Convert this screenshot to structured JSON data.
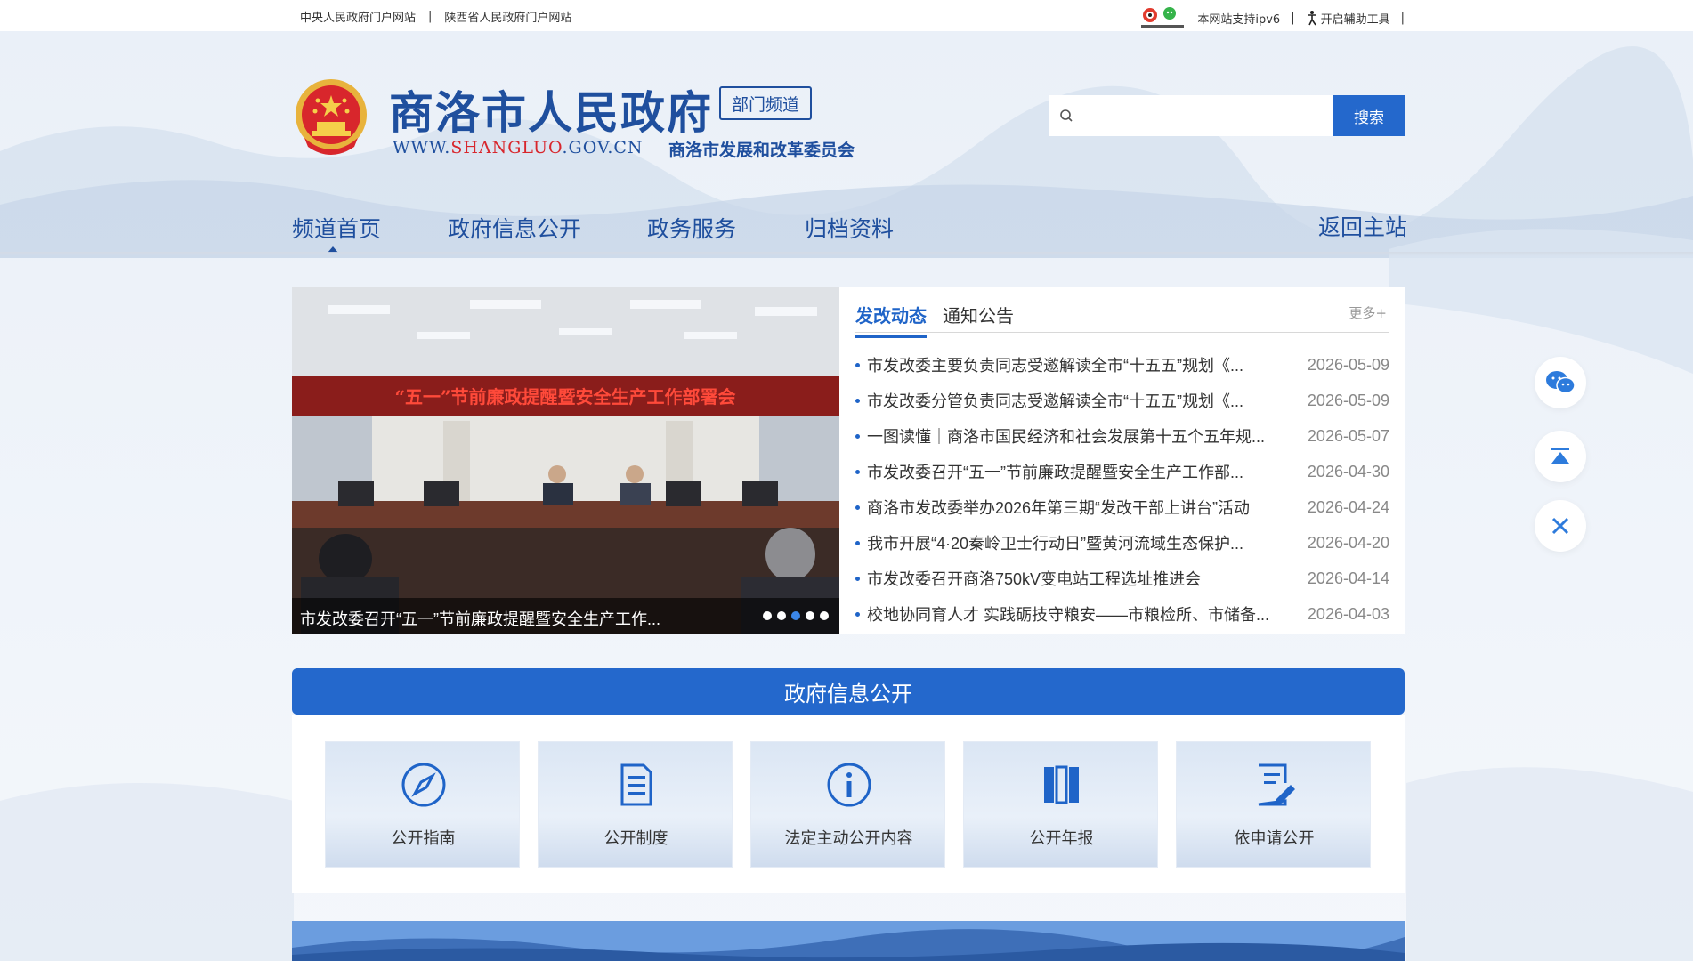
{
  "topbar": {
    "links": [
      "中央人民政府门户网站",
      "陕西省人民政府门户网站"
    ],
    "ipv6": "本网站支持ipv6",
    "a11y": "开启辅助工具",
    "weibo_label": "政务新媒体矩阵"
  },
  "header": {
    "title": "商洛市人民政府",
    "badge": "部门频道",
    "url_prefix": "WWW.",
    "url_highlight": "SHANGLUO",
    "url_suffix": ".GOV.CN",
    "dept": "商洛市发展和改革委员会"
  },
  "search": {
    "placeholder": "",
    "button": "搜索"
  },
  "nav": {
    "items": [
      "频道首页",
      "政府信息公开",
      "政务服务",
      "归档资料"
    ],
    "back": "返回主站",
    "active_index": 0
  },
  "slider": {
    "banner_text": "“五一”节前廉政提醒暨安全生产工作部署会",
    "caption": "市发改委召开“五一”节前廉政提醒暨安全生产工作...",
    "dots": 5,
    "active_dot": 2
  },
  "news": {
    "tabs": [
      "发改动态",
      "通知公告"
    ],
    "active_tab": 0,
    "more": "更多+",
    "items": [
      {
        "title": "市发改委主要负责同志受邀解读全市“十五五”规划《...",
        "date": "2026-05-09"
      },
      {
        "title": "市发改委分管负责同志受邀解读全市“十五五”规划《...",
        "date": "2026-05-09"
      },
      {
        "title": "一图读懂｜商洛市国民经济和社会发展第十五个五年规...",
        "date": "2026-05-07"
      },
      {
        "title": "市发改委召开“五一”节前廉政提醒暨安全生产工作部...",
        "date": "2026-04-30"
      },
      {
        "title": "商洛市发改委举办2026年第三期“发改干部上讲台”活动",
        "date": "2026-04-24"
      },
      {
        "title": "我市开展“4·20秦岭卫士行动日”暨黄河流域生态保护...",
        "date": "2026-04-20"
      },
      {
        "title": "市发改委召开商洛750kV变电站工程选址推进会",
        "date": "2026-04-14"
      },
      {
        "title": "校地协同育人才 实践砺技守粮安——市粮检所、市储备...",
        "date": "2026-04-03"
      }
    ]
  },
  "disclosure": {
    "title": "政府信息公开",
    "cards": [
      {
        "label": "公开指南",
        "icon": "compass-icon"
      },
      {
        "label": "公开制度",
        "icon": "document-icon"
      },
      {
        "label": "法定主动公开内容",
        "icon": "info-icon"
      },
      {
        "label": "公开年报",
        "icon": "books-icon"
      },
      {
        "label": "依申请公开",
        "icon": "edit-form-icon"
      }
    ]
  },
  "side_tools": [
    "wechat-icon",
    "back-to-top-icon",
    "close-icon"
  ],
  "colors": {
    "brand": "#1f4f9e",
    "accent": "#2468cc",
    "emblem_red": "#d8262c"
  }
}
